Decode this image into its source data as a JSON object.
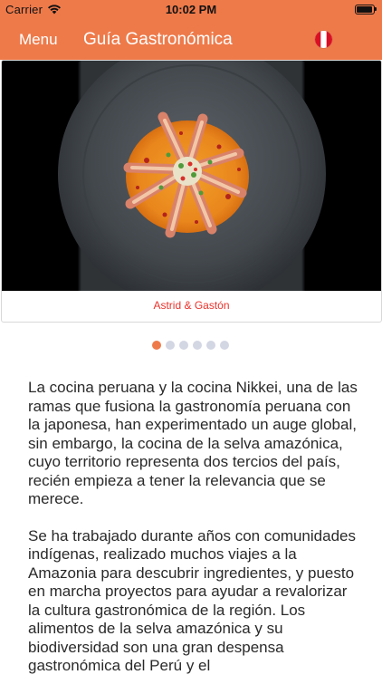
{
  "status_bar": {
    "carrier": "Carrier",
    "time": "10:02 PM",
    "wifi_icon": "wifi-icon",
    "battery_icon": "battery-icon"
  },
  "nav": {
    "menu_label": "Menu",
    "title": "Guía Gastronómica",
    "flag_icon": "peru-flag-icon"
  },
  "colors": {
    "accent": "#ee7a4a",
    "caption": "#e8332c",
    "dot_inactive": "#d3d6e3"
  },
  "gallery": {
    "caption": "Astrid & Gastón",
    "page_count": 6,
    "current_page": 1
  },
  "article": {
    "paragraphs": [
      "La cocina peruana y la cocina Nikkei, una de las ramas que fusiona la gastronomía peruana con la japonesa, han experimentado un auge global, sin embargo, la cocina de la selva amazónica, cuyo territorio representa dos tercios del país, recién empieza a tener la relevancia que se merece.",
      "Se ha trabajado durante años con comunidades indígenas, realizado muchos viajes a la Amazonia para descubrir ingredientes, y puesto en marcha proyectos para ayudar a revalorizar la cultura gastronómica de la región. Los alimentos de la selva amazónica y su biodiversidad son una gran despensa gastronómica del Perú y el"
    ]
  }
}
